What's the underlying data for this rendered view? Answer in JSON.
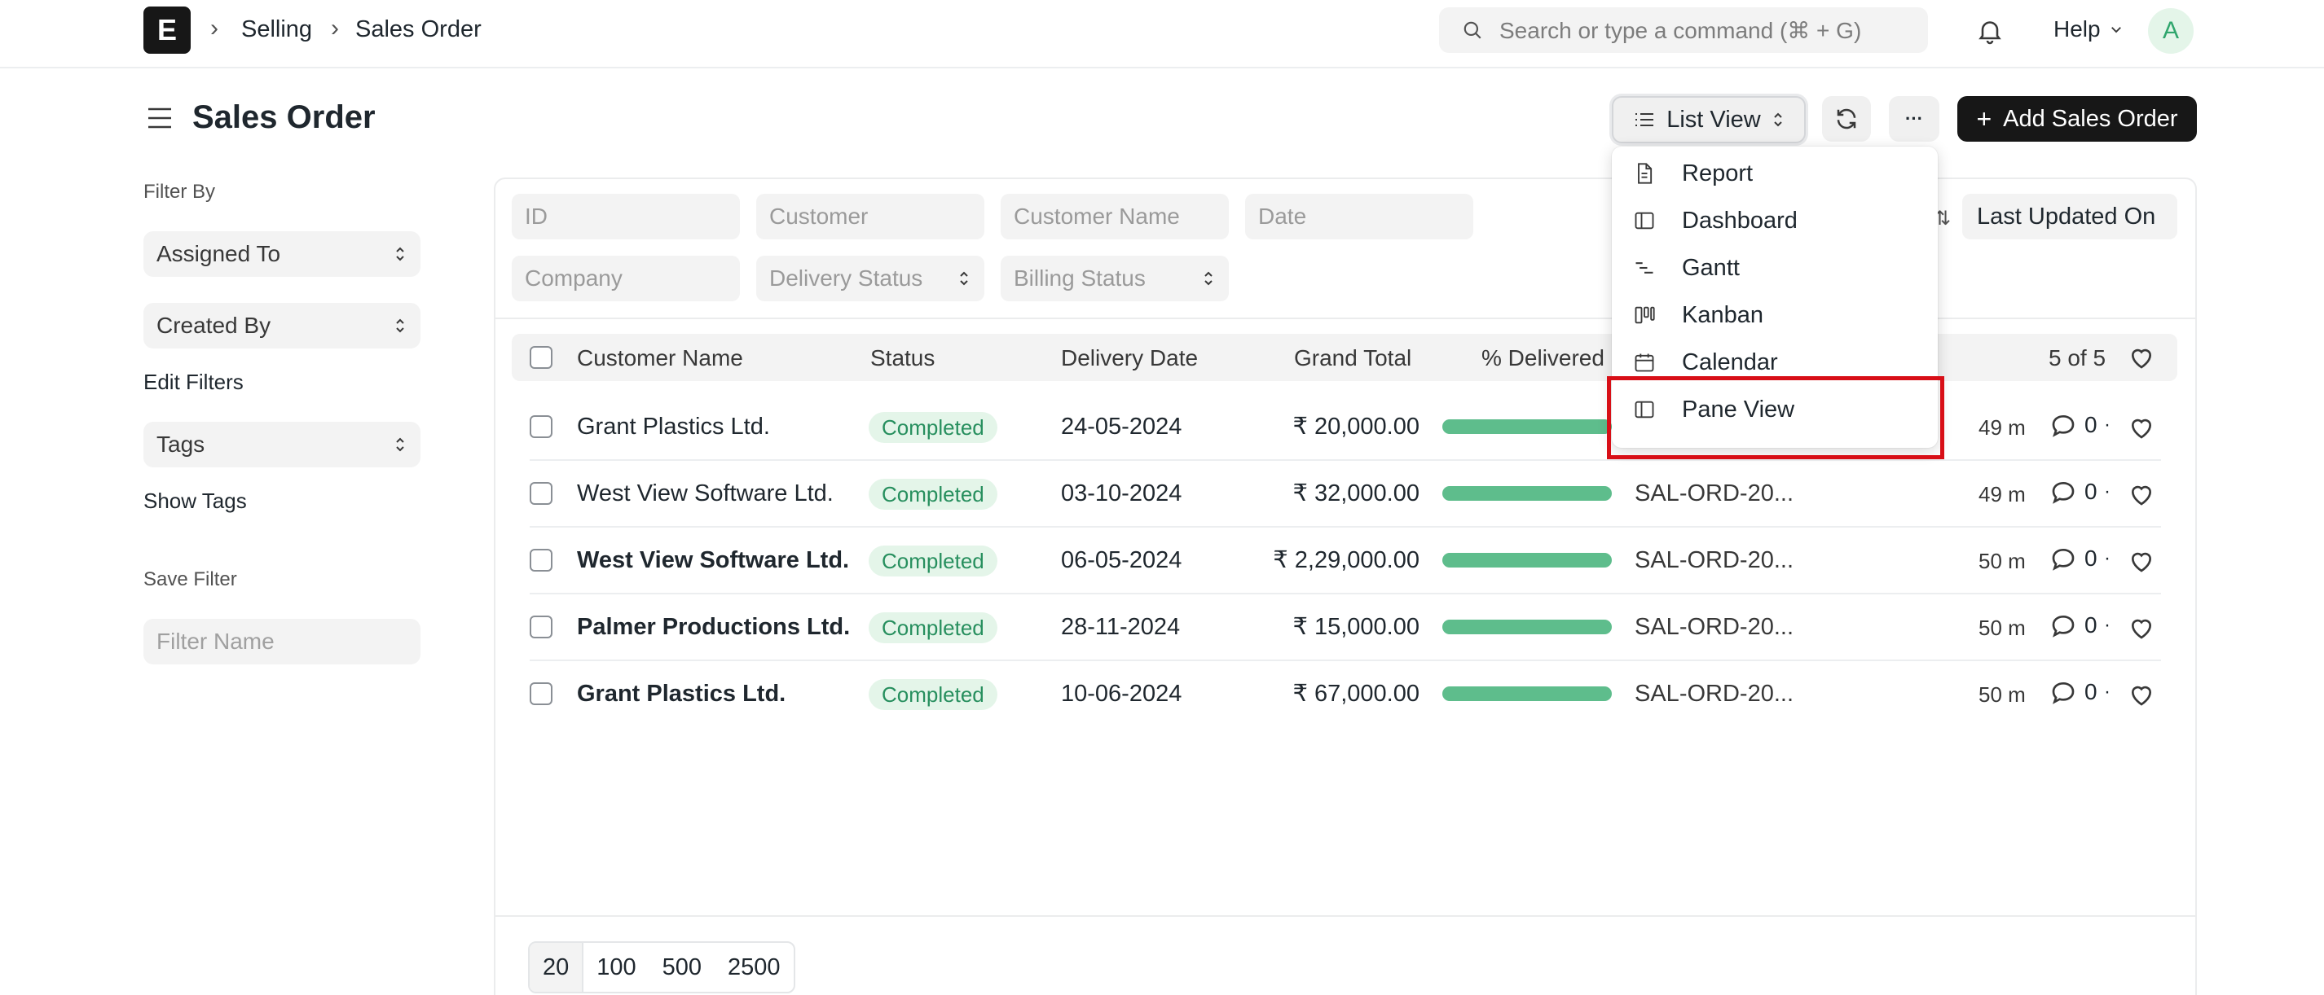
{
  "nav": {
    "logo": "E",
    "breadcrumbs": [
      "Selling",
      "Sales Order"
    ],
    "search_placeholder": "Search or type a command (⌘ + G)",
    "help": "Help",
    "avatar": "A"
  },
  "page": {
    "title": "Sales Order",
    "view_label": "List View",
    "add_label": "Add Sales Order",
    "more_label": "···"
  },
  "sidebar": {
    "filter_by": "Filter By",
    "assigned_to": "Assigned To",
    "created_by": "Created By",
    "edit_filters": "Edit Filters",
    "tags": "Tags",
    "show_tags": "Show Tags",
    "save_filter": "Save Filter",
    "filter_name_placeholder": "Filter Name"
  },
  "filters": {
    "id": "ID",
    "customer": "Customer",
    "customer_name": "Customer Name",
    "date": "Date",
    "company": "Company",
    "delivery_status": "Delivery Status",
    "billing_status": "Billing Status",
    "sort_label": "Last Updated On"
  },
  "table": {
    "headers": {
      "customer_name": "Customer Name",
      "status": "Status",
      "delivery_date": "Delivery Date",
      "grand_total": "Grand Total",
      "delivered": "% Delivered"
    },
    "count": "5 of 5",
    "rows": [
      {
        "customer": "Grant Plastics Ltd.",
        "status": "Completed",
        "date": "24-05-2024",
        "total": "₹ 20,000.00",
        "delivered_pct": 100,
        "id": "",
        "time": "49 m",
        "comments": "0",
        "bold": false
      },
      {
        "customer": "West View Software Ltd.",
        "status": "Completed",
        "date": "03-10-2024",
        "total": "₹ 32,000.00",
        "delivered_pct": 100,
        "id": "SAL-ORD-20...",
        "time": "49 m",
        "comments": "0",
        "bold": false
      },
      {
        "customer": "West View Software Ltd.",
        "status": "Completed",
        "date": "06-05-2024",
        "total": "₹ 2,29,000.00",
        "delivered_pct": 100,
        "id": "SAL-ORD-20...",
        "time": "50 m",
        "comments": "0",
        "bold": true
      },
      {
        "customer": "Palmer Productions Ltd.",
        "status": "Completed",
        "date": "28-11-2024",
        "total": "₹ 15,000.00",
        "delivered_pct": 100,
        "id": "SAL-ORD-20...",
        "time": "50 m",
        "comments": "0",
        "bold": true
      },
      {
        "customer": "Grant Plastics Ltd.",
        "status": "Completed",
        "date": "10-06-2024",
        "total": "₹ 67,000.00",
        "delivered_pct": 100,
        "id": "SAL-ORD-20...",
        "time": "50 m",
        "comments": "0",
        "bold": true
      }
    ]
  },
  "pager": [
    "20",
    "100",
    "500",
    "2500"
  ],
  "view_menu": {
    "items": [
      "Report",
      "Dashboard",
      "Gantt",
      "Kanban",
      "Calendar",
      "Pane View"
    ],
    "highlighted": "Pane View"
  },
  "colors": {
    "badge_bg": "#e4f5e9",
    "badge_text": "#278f5e",
    "progress": "#5ebd8c",
    "primary_button": "#171717",
    "highlight": "#d80f17"
  }
}
